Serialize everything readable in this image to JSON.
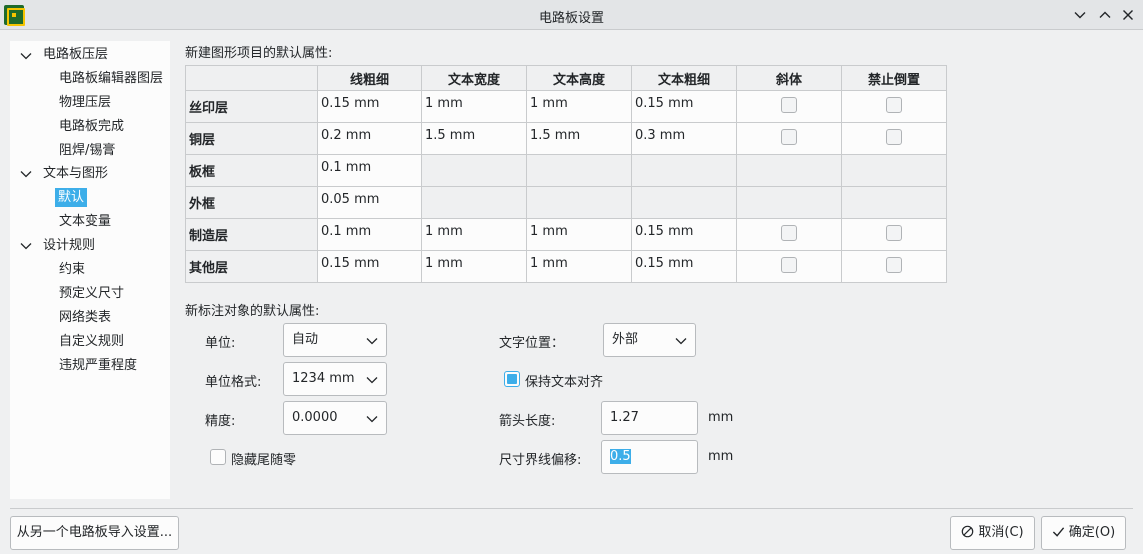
{
  "window": {
    "title": "电路板设置"
  },
  "tree": {
    "items": [
      {
        "label": "电路板压层",
        "level": 0,
        "expanded": true
      },
      {
        "label": "电路板编辑器图层",
        "level": 1
      },
      {
        "label": "物理压层",
        "level": 1
      },
      {
        "label": "电路板完成",
        "level": 1
      },
      {
        "label": "阻焊/锡膏",
        "level": 1
      },
      {
        "label": "文本与图形",
        "level": 0,
        "expanded": true
      },
      {
        "label": "默认",
        "level": 1,
        "selected": true
      },
      {
        "label": "文本变量",
        "level": 1
      },
      {
        "label": "设计规则",
        "level": 0,
        "expanded": true
      },
      {
        "label": "约束",
        "level": 1
      },
      {
        "label": "预定义尺寸",
        "level": 1
      },
      {
        "label": "网络类表",
        "level": 1
      },
      {
        "label": "自定义规则",
        "level": 1
      },
      {
        "label": "违规严重程度",
        "level": 1
      }
    ]
  },
  "graphics": {
    "section_label": "新建图形项目的默认属性:",
    "columns": [
      "线粗细",
      "文本宽度",
      "文本高度",
      "文本粗细",
      "斜体",
      "禁止倒置"
    ],
    "rows": [
      {
        "name": "丝印层",
        "line": "0.15 mm",
        "tw": "1 mm",
        "th": "1 mm",
        "tt": "0.15 mm",
        "italic": false,
        "keep_upright": false,
        "has_text": true
      },
      {
        "name": "铜层",
        "line": "0.2 mm",
        "tw": "1.5 mm",
        "th": "1.5 mm",
        "tt": "0.3 mm",
        "italic": false,
        "keep_upright": false,
        "has_text": true
      },
      {
        "name": "板框",
        "line": "0.1 mm",
        "has_text": false
      },
      {
        "name": "外框",
        "line": "0.05 mm",
        "has_text": false
      },
      {
        "name": "制造层",
        "line": "0.1 mm",
        "tw": "1 mm",
        "th": "1 mm",
        "tt": "0.15 mm",
        "italic": false,
        "keep_upright": false,
        "has_text": true
      },
      {
        "name": "其他层",
        "line": "0.15 mm",
        "tw": "1 mm",
        "th": "1 mm",
        "tt": "0.15 mm",
        "italic": false,
        "keep_upright": false,
        "has_text": true
      }
    ]
  },
  "dimensions": {
    "section_label": "新标注对象的默认属性:",
    "units_label": "单位:",
    "units_value": "自动",
    "format_label": "单位格式:",
    "format_value": "1234 mm",
    "precision_label": "精度:",
    "precision_value": "0.0000",
    "suppress_zeros_label": "隐藏尾随零",
    "suppress_zeros_checked": false,
    "text_pos_label": "文字位置：",
    "text_pos_value": "外部",
    "keep_aligned_label": "保持文本对齐",
    "keep_aligned_checked": true,
    "arrow_len_label": "箭头长度:",
    "arrow_len_value": "1.27",
    "arrow_len_unit": "mm",
    "ext_offset_label": "尺寸界线偏移:",
    "ext_offset_value": "0.5",
    "ext_offset_unit": "mm"
  },
  "footer": {
    "import_label": "从另一个电路板导入设置...",
    "cancel_label": "取消(C)",
    "ok_label": "确定(O)"
  }
}
